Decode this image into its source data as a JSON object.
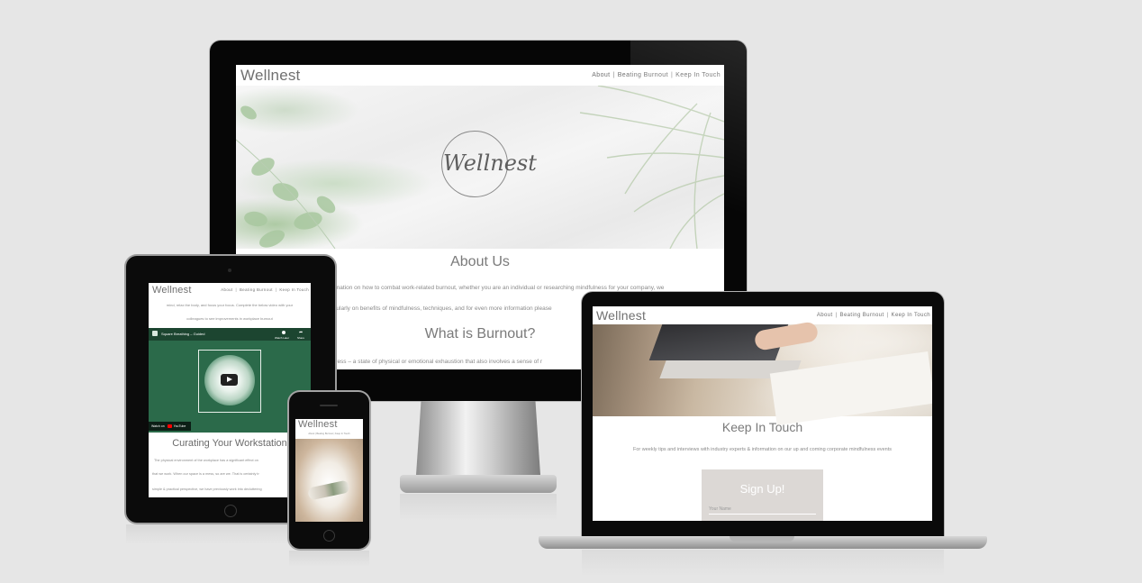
{
  "brand": "Wellnest",
  "logo_script": "Wellnest",
  "nav": {
    "about": "About",
    "burnout": "Beating Burnout",
    "keep": "Keep In Touch",
    "sep": "|"
  },
  "desktop": {
    "about_heading": "About Us",
    "about_text_1": "... information on how to combat work-related burnout, whether you are an individual or researching mindfulness for your company, we",
    "about_text_2": "regularly on benefits of mindfulness, techniques, and for even more information please",
    "burnout_heading": "What is Burnout?",
    "burnout_text": "... stress – a state of physical or emotional exhaustion that also involves a sense of r"
  },
  "laptop": {
    "keep_heading": "Keep In Touch",
    "keep_text": "For weekly tips and interviews with industry experts & information on our up and coming corporate mindfulness events",
    "signup_heading": "Sign Up!",
    "name_placeholder": "Your Name"
  },
  "tablet": {
    "intro_text_1": "mind, relax the body, and focus your focus. Complete the below video with your",
    "intro_text_2": "colleagues to see improvements in workplace burnout",
    "video_title": "Square Breathing – Guided",
    "watch_later": "Watch Later",
    "share": "Share",
    "watch_on": "Watch on",
    "youtube": "YouTube",
    "section_heading": "Curating Your Workstation",
    "text_1": "The physical environment of the workplace has a significant effect on",
    "text_2": "that we work. When our space is a mess, so are we. That is certainly tr",
    "text_3": "simple & practical perspective, we have previously work into decluttering"
  },
  "phone": {
    "nav_text": "About | Beating Burnout | Keep In Touch"
  },
  "colors": {
    "background": "#e6e6e6",
    "device_black": "#0a0a0a",
    "text_grey": "#707070",
    "video_green": "#2b6a4a",
    "signup_box": "#dcd8d5"
  }
}
